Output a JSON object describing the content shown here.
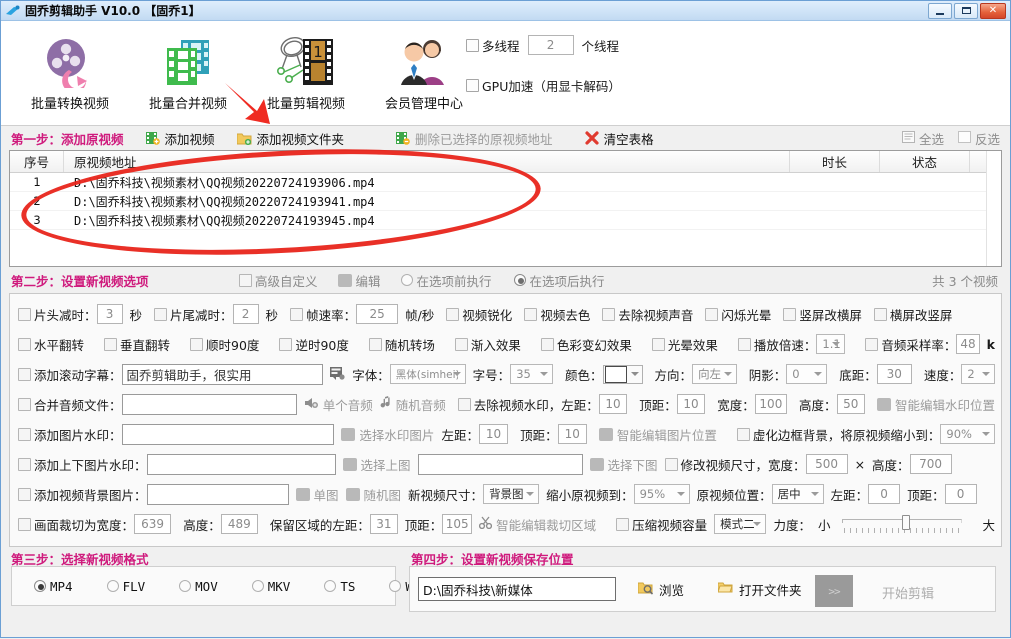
{
  "window": {
    "title": "固乔剪辑助手 V10.0  【固乔1】",
    "minimize": "–",
    "maximize": "▫",
    "close": "✕"
  },
  "toolbar": {
    "items": [
      {
        "label": "批量转换视频",
        "icon": "film-reel-icon"
      },
      {
        "label": "批量合并视频",
        "icon": "merge-video-icon"
      },
      {
        "label": "批量剪辑视频",
        "icon": "film-strip-scissors-icon"
      },
      {
        "label": "会员管理中心",
        "icon": "members-icon"
      }
    ],
    "multithread": {
      "label": "多线程",
      "value": "2",
      "unit": "个线程",
      "checked": false
    },
    "gpu": {
      "label": "GPU加速（用显卡解码）",
      "checked": false
    }
  },
  "step1": {
    "title": "第一步：添加原视频",
    "add_video": "添加视频",
    "add_folder": "添加视频文件夹",
    "delete_selected": "删除已选择的原视频地址",
    "clear_table": "清空表格",
    "select_all": "全选",
    "invert_select": "反选"
  },
  "table": {
    "columns": [
      "序号",
      "原视频地址",
      "时长",
      "状态"
    ],
    "rows": [
      {
        "index": "1",
        "path": "D:\\固乔科技\\视频素材\\QQ视频20220724193906.mp4",
        "duration": "",
        "status": ""
      },
      {
        "index": "2",
        "path": "D:\\固乔科技\\视频素材\\QQ视频20220724193941.mp4",
        "duration": "",
        "status": ""
      },
      {
        "index": "3",
        "path": "D:\\固乔科技\\视频素材\\QQ视频20220724193945.mp4",
        "duration": "",
        "status": ""
      }
    ]
  },
  "step2": {
    "title": "第二步：设置新视频选项",
    "advanced_custom": "高级自定义",
    "edit": "编辑",
    "before_option": "在选项前执行",
    "after_option": "在选项后执行",
    "after_option_selected": true,
    "count_text": "共 3 个视频"
  },
  "options": {
    "row1": {
      "head_trim": {
        "label": "片头减时：",
        "value": "3",
        "unit": "秒"
      },
      "tail_trim": {
        "label": "片尾减时：",
        "value": "2",
        "unit": "秒"
      },
      "frame_rate": {
        "label": "帧速率：",
        "value": "25",
        "unit": "帧/秒"
      },
      "sharpen": "视频锐化",
      "decolor": "视频去色",
      "remove_audio": "去除视频声音",
      "flicker_halo": "闪烁光晕",
      "v2h": "竖屏改横屏",
      "h2v": "横屏改竖屏"
    },
    "row2": {
      "hflip": "水平翻转",
      "vflip": "垂直翻转",
      "rot_cw90": "顺时90度",
      "rot_ccw90": "逆时90度",
      "random_transition": "随机转场",
      "fade_in": "渐入效果",
      "color_shift": "色彩变幻效果",
      "halo": "光晕效果",
      "speed": {
        "label": "播放倍速：",
        "value": "1.1"
      },
      "sample_rate": {
        "label": "音频采样率：",
        "value": "48",
        "unit": "k"
      }
    },
    "row3": {
      "scroll_subtitle": {
        "label": "添加滚动字幕：",
        "value": "固乔剪辑助手，很实用"
      },
      "font": {
        "label": "字体：",
        "value": "黑体(simhei)"
      },
      "font_size": {
        "label": "字号：",
        "value": "35"
      },
      "color": {
        "label": "颜色：",
        "value": "#ffffff"
      },
      "direction": {
        "label": "方向：",
        "value": "向左"
      },
      "shadow": {
        "label": "阴影：",
        "value": "0"
      },
      "bottom_margin": {
        "label": "底距：",
        "value": "30"
      },
      "speed": {
        "label": "速度：",
        "value": "2"
      }
    },
    "row4": {
      "merge_audio": {
        "label": "合并音频文件：",
        "value": ""
      },
      "single_audio": "单个音频",
      "random_audio": "随机音频",
      "remove_watermark": "去除视频水印，左距：",
      "left": "10",
      "top_label": "顶距：",
      "top": "10",
      "width_label": "宽度：",
      "width": "100",
      "height_label": "高度：",
      "height": "50",
      "smart_edit": "智能编辑水印位置"
    },
    "row5": {
      "add_image_watermark": {
        "label": "添加图片水印：",
        "value": ""
      },
      "choose_watermark": "选择水印图片",
      "left_label": "左距：",
      "left": "10",
      "top_label": "顶距：",
      "top": "10",
      "smart_edit_img": "智能编辑图片位置",
      "blur_border": "虚化边框背景，将原视频缩小到：",
      "blur_value": "90%"
    },
    "row6": {
      "add_tb_watermark": {
        "label": "添加上下图片水印：",
        "value": ""
      },
      "choose_top": "选择上图",
      "second_value": "",
      "choose_bottom": "选择下图",
      "resize": "修改视频尺寸，宽度：",
      "width": "500",
      "x": "×",
      "height_label": "高度：",
      "height": "700"
    },
    "row7": {
      "add_bg_image": {
        "label": "添加视频背景图片：",
        "value": ""
      },
      "single_img": "单图",
      "random_img": "随机图",
      "new_size_label": "新视频尺寸：",
      "new_size": "背景图",
      "shrink_label": "缩小原视频到：",
      "shrink": "95%",
      "pos_label": "原视频位置：",
      "pos": "居中",
      "left_label": "左距：",
      "left": "0",
      "top_label": "顶距：",
      "top": "0"
    },
    "row8": {
      "crop_label": "画面裁切为宽度：",
      "crop_width": "639",
      "height_label": "高度：",
      "crop_height": "489",
      "keep_left_label": "保留区域的左距：",
      "keep_left": "31",
      "keep_top_label": "顶距：",
      "keep_top": "105",
      "smart_crop": "智能编辑裁切区域",
      "compress": "压缩视频容量",
      "mode": "模式二",
      "strength_label": "力度：",
      "small": "小",
      "large": "大"
    }
  },
  "step3": {
    "title": "第三步：选择新视频格式",
    "formats": [
      "MP4",
      "FLV",
      "MOV",
      "MKV",
      "TS",
      "WMV"
    ],
    "selected": "MP4"
  },
  "step4": {
    "title": "第四步：设置新视频保存位置",
    "path": "D:\\固乔科技\\新媒体",
    "browse": "浏览",
    "open_folder": "打开文件夹",
    "start_button": "开始剪辑"
  },
  "colors": {
    "step_title": "#cf1b7d",
    "annotation": "#e8251b",
    "title_bar": "#cfe3f7"
  }
}
